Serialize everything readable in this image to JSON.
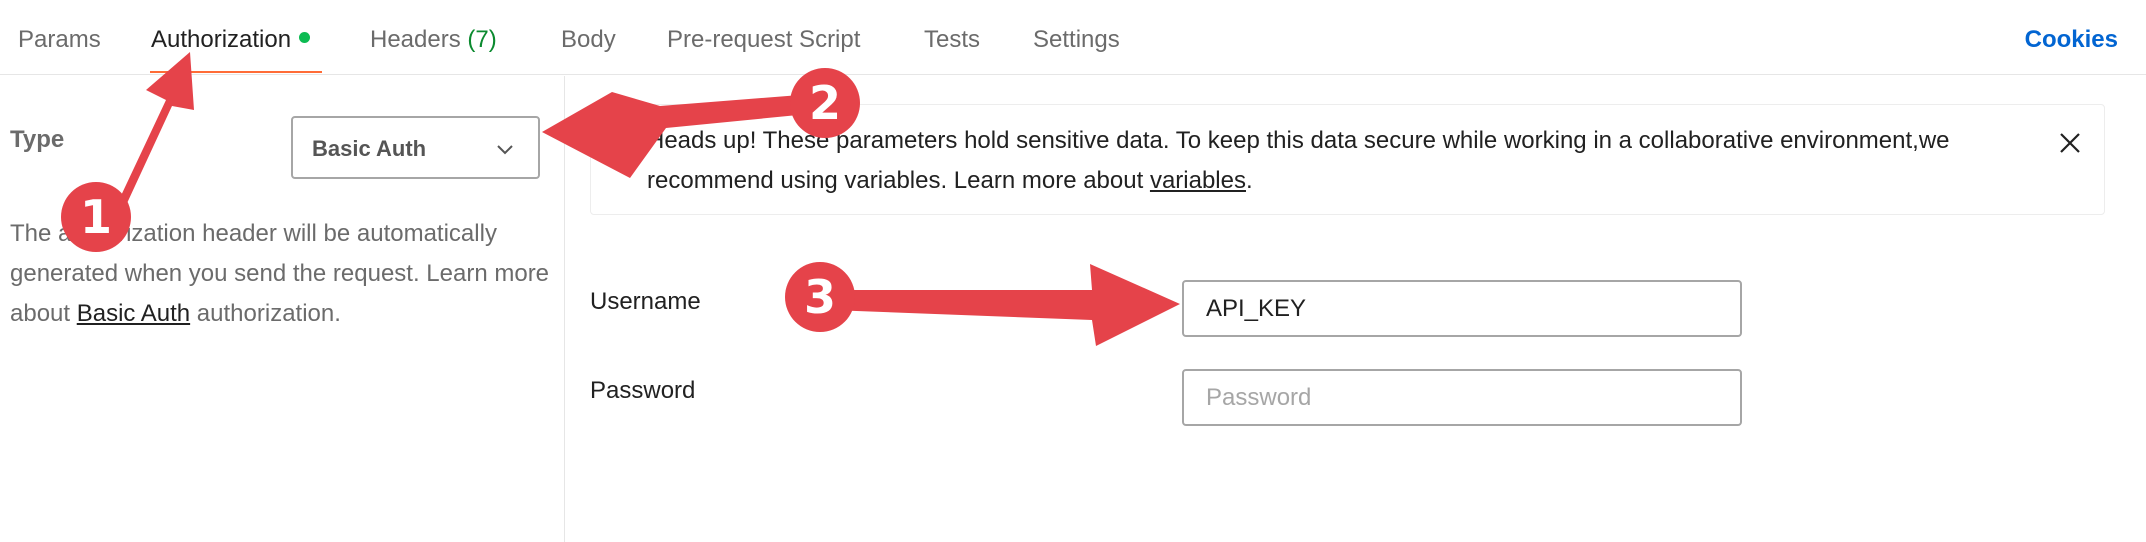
{
  "tabs": [
    {
      "label": "Params"
    },
    {
      "label": "Authorization"
    },
    {
      "label": "Headers",
      "count": "(7)"
    },
    {
      "label": "Body"
    },
    {
      "label": "Pre-request Script"
    },
    {
      "label": "Tests"
    },
    {
      "label": "Settings"
    }
  ],
  "cookies_label": "Cookies",
  "auth": {
    "type_label": "Type",
    "type_value": "Basic Auth",
    "desc_prefix": "The authorization header will be automatically generated when you send the request. Learn more about ",
    "desc_link": "Basic Auth",
    "desc_suffix": " authorization."
  },
  "banner": {
    "text": "Heads up! These parameters hold sensitive data. To keep this data secure while working in a collaborative environment,we recommend using variables. Learn more about ",
    "link": "variables",
    "suffix": "."
  },
  "fields": {
    "username_label": "Username",
    "username_value": "API_KEY",
    "password_label": "Password",
    "password_placeholder": "Password"
  },
  "annotations": [
    {
      "label": "1"
    },
    {
      "label": "2"
    },
    {
      "label": "3"
    }
  ],
  "colors": {
    "accent_tab": "#ff6c37",
    "status_dot": "#0cbb52",
    "link_blue": "#0265d2",
    "annotation_red": "#e5434a"
  }
}
